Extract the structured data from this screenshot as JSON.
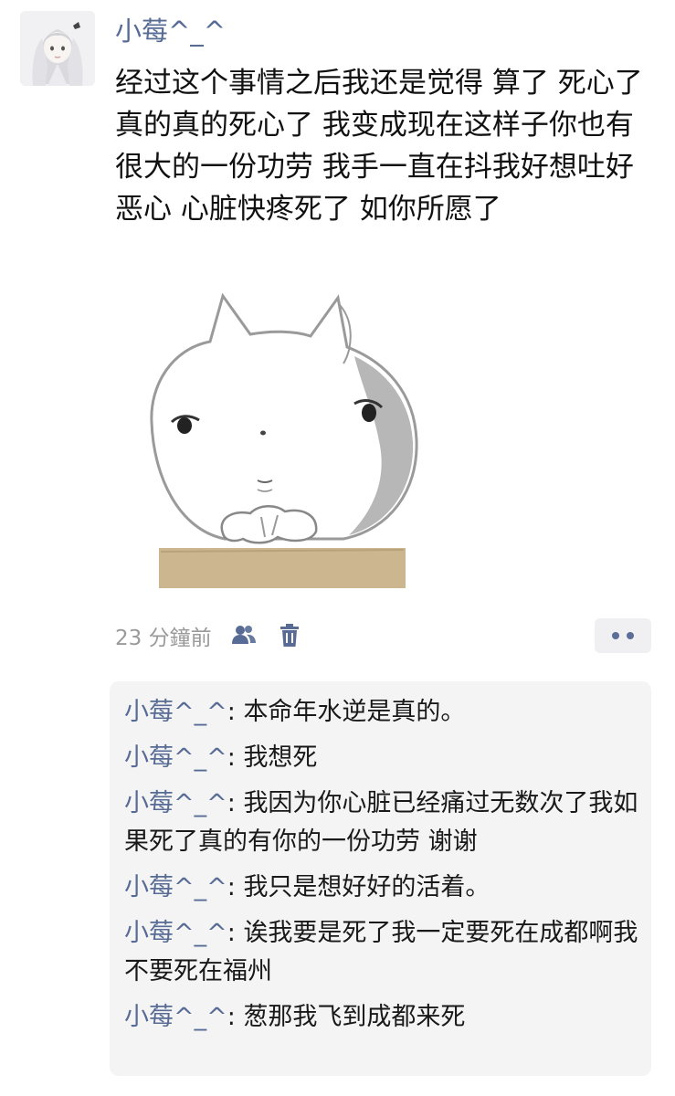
{
  "post": {
    "username": "小莓^_^",
    "text": "经过这个事情之后我还是觉得 算了 死心了 真的真的死心了 我变成现在这样子你也有很大的一份功劳 我手一直在抖我好想吐好恶心 心脏快疼死了 如你所愿了",
    "time": "23 分鐘前"
  },
  "icons": {
    "privacy": "people-icon",
    "delete": "trash-icon",
    "more": "more-dots-icon",
    "accent": "#576b95"
  },
  "comments": [
    {
      "name": "小莓^_^",
      "sep": ": ",
      "text": "本命年水逆是真的。"
    },
    {
      "name": "小莓^_^",
      "sep": ": ",
      "text": "我想死"
    },
    {
      "name": "小莓^_^",
      "sep": ": ",
      "text": "我因为你心脏已经痛过无数次了我如果死了真的有你的一份功劳 谢谢"
    },
    {
      "name": "小莓^_^",
      "sep": ": ",
      "text": "我只是想好好的活着。"
    },
    {
      "name": "小莓^_^",
      "sep": ": ",
      "text": "诶我要是死了我一定要死在成都啊我不要死在福州"
    },
    {
      "name": "小莓^_^",
      "sep": ": ",
      "text": "葱那我飞到成都来死"
    }
  ]
}
